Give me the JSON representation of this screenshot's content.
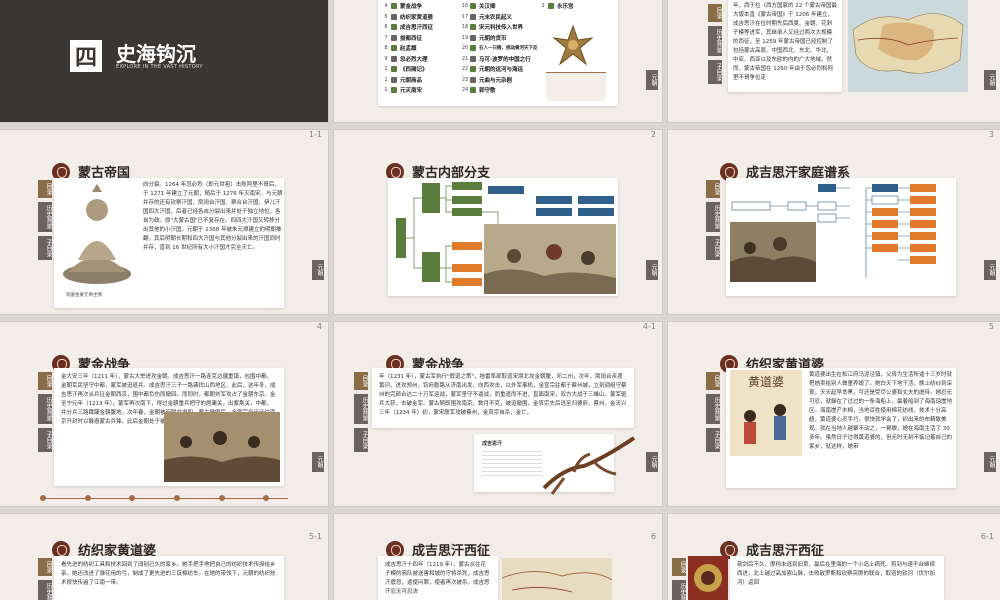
{
  "section": {
    "number": "四",
    "title": "史海钩沉",
    "subtitle": "EXPLORE IN THE VAST HISTORY"
  },
  "catalog_left": [
    {
      "n": "4",
      "label": "蒙金战争"
    },
    {
      "n": "5",
      "label": "纺织家黄道婆"
    },
    {
      "n": "6",
      "label": "成吉思汗西征"
    },
    {
      "n": "7",
      "label": "拔都西征"
    },
    {
      "n": "8",
      "label": "赵孟頫"
    },
    {
      "n": "9",
      "label": "忽必烈大理"
    },
    {
      "n": "1",
      "label": "《西厢记》"
    },
    {
      "n": "1",
      "label": "元朝商品"
    },
    {
      "n": "1",
      "label": "元灭南宋"
    }
  ],
  "catalog_right": [
    {
      "n": "16",
      "label": "关汉卿"
    },
    {
      "n": "17",
      "label": "元末农民起义"
    },
    {
      "n": "18",
      "label": "宋元科技传入世界"
    },
    {
      "n": "19",
      "label": "元朝的货币"
    },
    {
      "n": "20",
      "label": "石人一只眼，挑动黄河天下反"
    },
    {
      "n": "21",
      "label": "马可·波罗的中国之行"
    },
    {
      "n": "22",
      "label": "元朝的运河与海运"
    },
    {
      "n": "23",
      "label": "元曲与元杂剧"
    },
    {
      "n": "24",
      "label": "郭守敬"
    }
  ],
  "catalog_extra": {
    "n": "2",
    "label": "永乐宫"
  },
  "side_tabs": [
    "目录",
    "历史背景",
    "子目录"
  ],
  "right_tab": "元朝",
  "slides": [
    {
      "num": "1-1",
      "title": "蒙古帝国",
      "text": "向分裂。1264 年忽必烈（即元世祖）击败阿里不哥后，于 1271 年建立了元朝，随后于 1276 年灭南宋。与元朝并存的还有钦察汗国、窝阔台汗国、察合台汗国、伊儿汗国四大汗国，后者已经各自分裂出来并处于独立地位，各自为政。原\"大蒙古国\"已不复存在。四四大汗国又转移分出其他的小汗国，元朝于 1368 年被朱元璋建立的明朝推翻，其后明朝长期和四大汗国与其他分裂出来的汗国同时并存，直到 16 世纪所有大小汗国才完全灭亡。",
      "caption": "铜鎏金蒙元佛坐像"
    },
    {
      "num": "2",
      "title": "蒙古内部分支"
    },
    {
      "num": "3",
      "title": "成吉思汗家庭谱系"
    },
    {
      "num": "4",
      "title": "蒙金战争",
      "text": "金大安三年（1211 年），蒙古大举进攻金朝。成吉思汗一路连克边疆重镇，包围中都。金朝军民坚守中都，蒙军被迫退兵。成吉思汗三子一路袭扰山西地区。此后，这年冬，成吉思汗再次派兵征金朝西京，围中都负伤而撤回。而同时，都朝刘军攻占了金朝东京。金至宁元年（1213 年），蒙军再次南下，得过金朝重兵把守的居庸关，出紫荆关，中都，并分兵三路蹂躏金朝腹地。次年春，金朝被迫献女求和，蒙古撤围后，金宣宗全迁迁往南京开封时以躲避蒙古兵锋。此后金朝处于被动，蒙关失陷被攻四十年。"
    },
    {
      "num": "4-1",
      "title": "蒙金战争",
      "text": "年（1231 年），蒙古军执行\"假道之策\"，拖雷率部取道宋境北攻金朝腹，邓二州，次年，窝阔台亲渡黄河，进攻郑州，钧府郡路从济南出发，向西攻击，以外军事机，金宣宗驻都于蔡州城，立刻调组守蔡州的完颜合达二十万军迎战，蒙军坚守不逼战，而重遣而不进，直面南宋，双方大战于三峰山，蒙军驱兵大获，击破金军。蒙古随即围攻南京，数月不克，被迫撤围，金哀宗先后逃至归德府、蔡州。金天兴三年（1234 年）初，蒙宋联军攻破蔡州，金哀宗自杀，金亡。",
      "caption": "成吉思汗"
    },
    {
      "num": "5",
      "title": "纺织家黄道婆",
      "text": "黄道婆出生在松江府乌泥泾镇，父母为生活所逼十三岁时就把她卖给别人做童养媳了。她白天下地干活，晚上纺纱到深夜，天天起早贪黑，可还是受尽公婆和丈夫的虐待。她忍无可忍，就躲在了过过的一条海船上，最着船到了海南琼崖地区。海南崖产木棉，当地百姓使用棉花纺线，技术十分高超，黄道婆心灵手巧，很快就学会了，织出来的布精致美观。就在当地人越聚不动之，一晃眼，她在海南生活了 30 多年。虽然日子过得黄道婆的，但无时无刻不惦记着自己的家乡，就这样，她带"
    },
    {
      "num": "5-1",
      "title": "纺织家黄道婆",
      "text": "看先进的纺织工具和技术回到了阔别已久的家乡。她手把手地把自己的纺织技术传授给乡亲。她还改进了弹花用的弓，制成了更先进的三锭棉纺车。在她的带领下，元朝的纺织技术很快传遍了江南一带。"
    },
    {
      "num": "6",
      "title": "成吉思汗西征",
      "text": "成吉思汗十四年（1219 年），蒙古派往花子模的商队被送害和城的守将杀死，成吉思汗震怒，遣使问罪，使者再次被杀。成吉思汗忍无可忍决"
    },
    {
      "num": "6-1",
      "title": "成吉思汗西征",
      "text": "韧剑后不久，摩柯未逃到旧草，最后在里海的一个小岛上病死。剪到与速不台继续西进，北上越过高加索山脉，击败敌罗斯和钦察突厥的联合，取道的钦河（伏尔加河）返回"
    }
  ],
  "map_text": "年，西于拉（西方国家的 22 个蒙古帝国最大版本直《蒙古帝国》于 1206 年建立，成吉思汗在位时期先后西夏、金朝、花刺子模等进军，其继承人又经过两次大规模的西征，至 1259 年蒙古帝国已经控制了包括蒙古高原、中国西北、东北、华北、中亚、西亚以及东欧的内的广大地域。然而，蒙古帝国在 1260 年由于忽必烈和阿里不哥争位走",
  "tree_boxes": {
    "root": "成吉思汗",
    "sons": [
      "术赤",
      "察合台",
      "窝阔台",
      "拖雷"
    ],
    "branches": [
      "钦察汗国",
      "察合台汗国",
      "窝阔台汗国",
      "伊儿汗国",
      "元朝"
    ]
  },
  "colors": {
    "accent": "#a46c4b",
    "dark": "#3a3634",
    "green": "#5a7d3e",
    "orange": "#e07b2c",
    "blue": "#2f5f8a"
  }
}
